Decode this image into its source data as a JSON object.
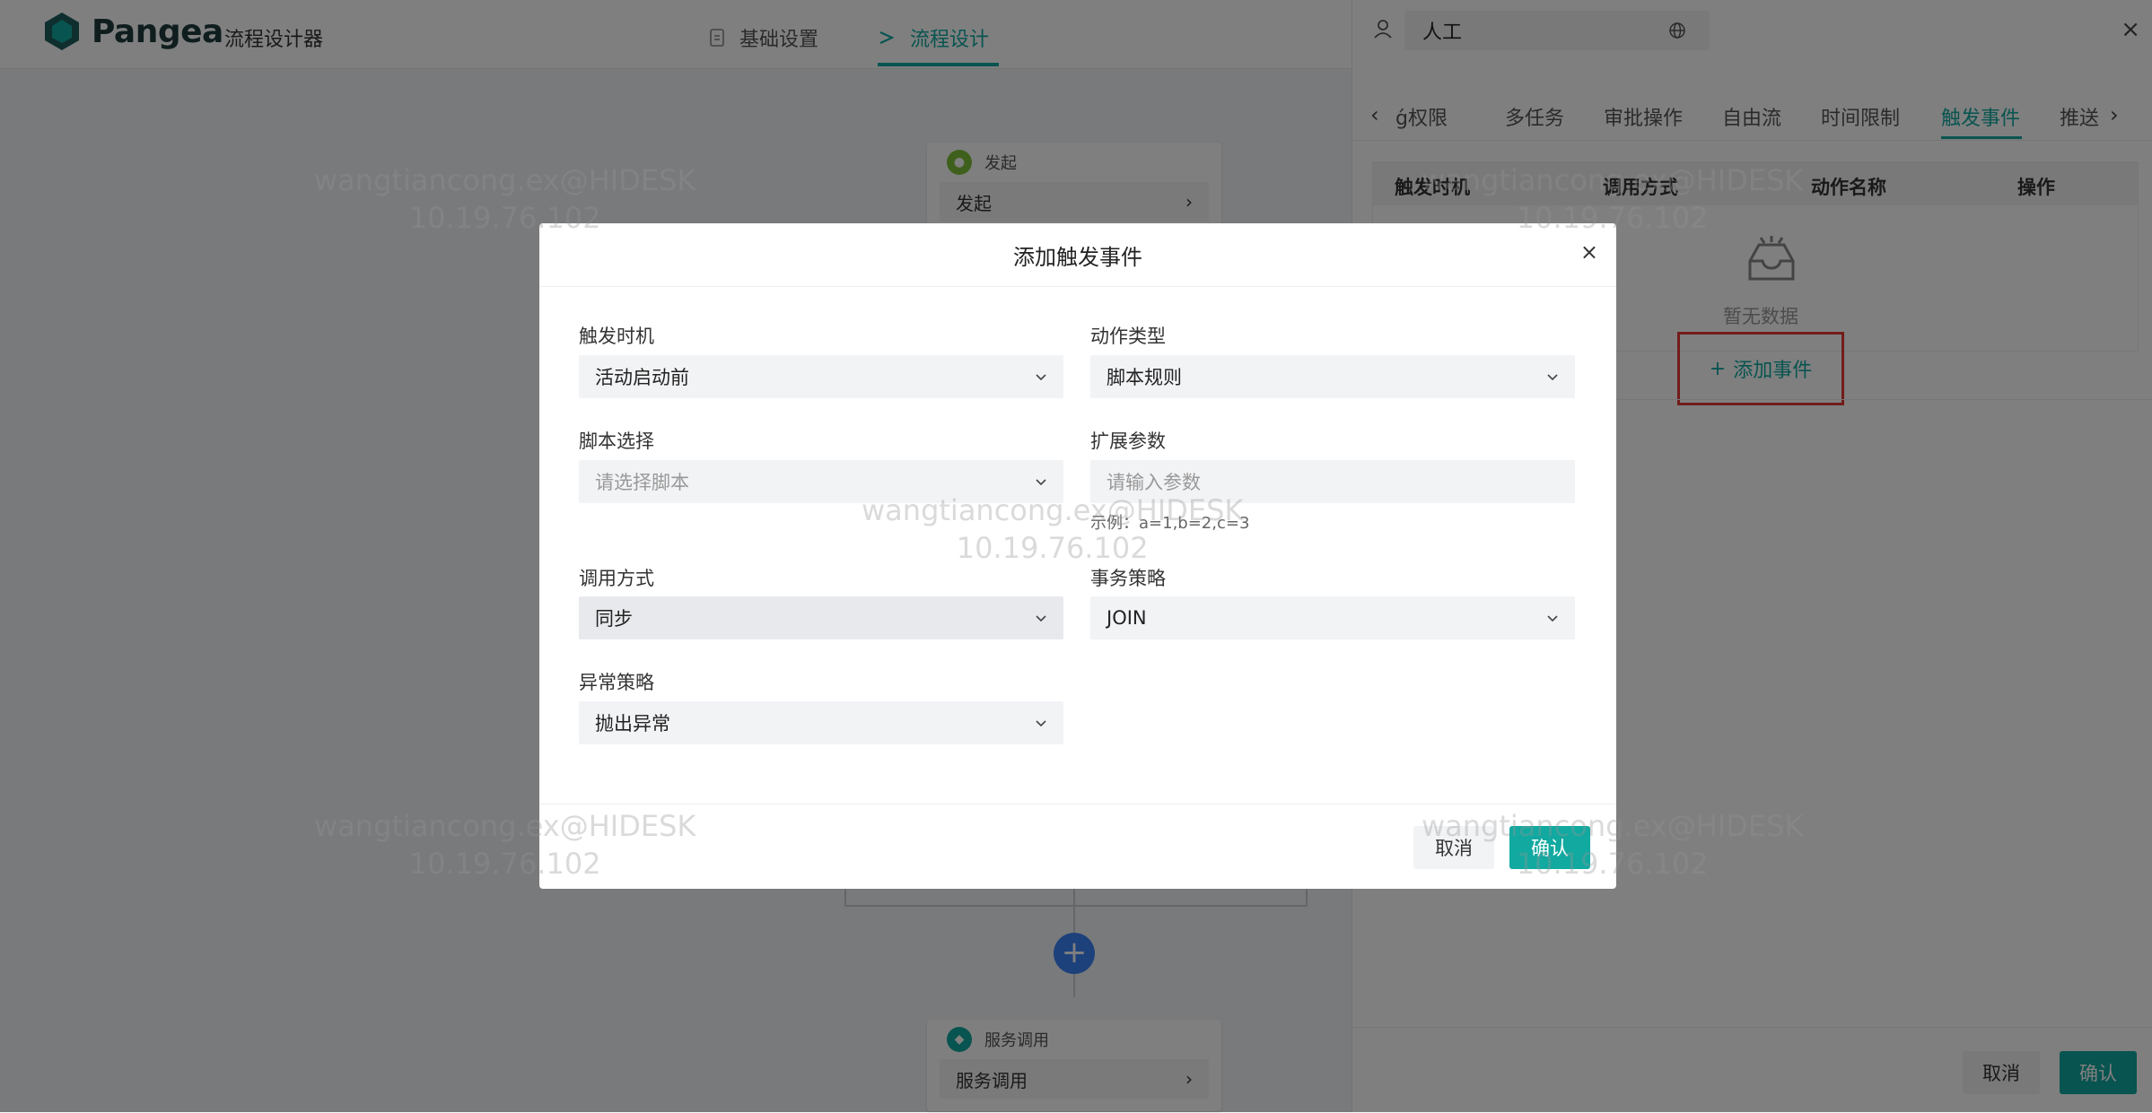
{
  "header": {
    "logo_text": "Pangea",
    "app_name": "流程设计器",
    "tabs": [
      {
        "label": "基础设置",
        "active": false
      },
      {
        "label": "流程设计",
        "active": true
      }
    ]
  },
  "canvas": {
    "start_node": {
      "title": "发起",
      "body": "发起"
    },
    "service_node": {
      "title": "服务调用",
      "body": "服务调用"
    }
  },
  "watermark": {
    "line1": "wangtiancong.ex@HIDESK",
    "line2": "10.19.76.102"
  },
  "drawer": {
    "name_value": "人工",
    "tabs": [
      {
        "label": "ǵ权限",
        "active": false
      },
      {
        "label": "多任务",
        "active": false
      },
      {
        "label": "审批操作",
        "active": false
      },
      {
        "label": "自由流",
        "active": false
      },
      {
        "label": "时间限制",
        "active": false
      },
      {
        "label": "触发事件",
        "active": true
      },
      {
        "label": "推送",
        "active": false
      }
    ],
    "table_headers": [
      "触发时机",
      "调用方式",
      "动作名称",
      "操作"
    ],
    "empty_text": "暂无数据",
    "add_event_label": "添加事件",
    "cancel_label": "取消",
    "confirm_label": "确认"
  },
  "modal": {
    "title": "添加触发事件",
    "fields": {
      "trigger_timing": {
        "label": "触发时机",
        "value": "活动启动前"
      },
      "action_type": {
        "label": "动作类型",
        "value": "脚本规则"
      },
      "script_select": {
        "label": "脚本选择",
        "placeholder": "请选择脚本"
      },
      "ext_params": {
        "label": "扩展参数",
        "placeholder": "请输入参数",
        "hint": "示例：a=1,b=2,c=3"
      },
      "call_mode": {
        "label": "调用方式",
        "value": "同步"
      },
      "transaction": {
        "label": "事务策略",
        "value": "JOIN"
      },
      "exception": {
        "label": "异常策略",
        "value": "抛出异常"
      }
    },
    "cancel_label": "取消",
    "confirm_label": "确认"
  },
  "colors": {
    "accent": "#11a9a0",
    "highlight_border": "#e53935"
  }
}
